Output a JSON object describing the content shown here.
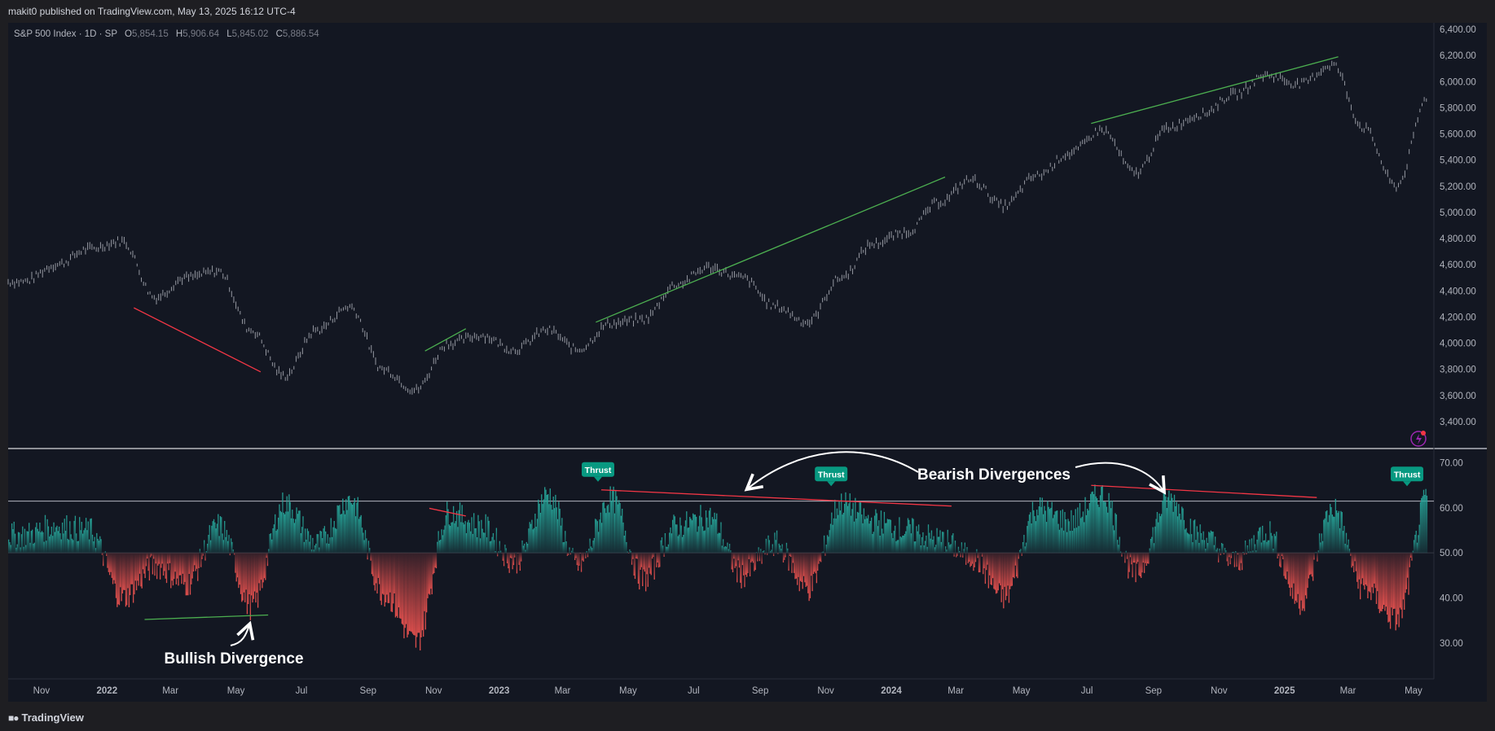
{
  "header": {
    "published": "makit0 published on TradingView.com, May 13, 2025 16:12 UTC-4"
  },
  "footer": {
    "brand": "TradingView",
    "logo_icon": "tradingview-logo-icon"
  },
  "legend": {
    "symbol": "S&P 500 Index · 1D · SP",
    "open_label": "O",
    "open": "5,854.15",
    "high_label": "H",
    "high": "5,906.64",
    "low_label": "L",
    "low": "5,845.02",
    "close_label": "C",
    "close": "5,886.54"
  },
  "colors": {
    "background": "#131722",
    "frame": "#1e1e22",
    "price": "#9598a1",
    "bull": "#26a69a",
    "bear": "#ef5350",
    "trend_green": "#4caf50",
    "trend_red": "#f23645",
    "thrust_badge": "#089981"
  },
  "chart_data": [
    {
      "type": "line",
      "title": "S&P 500 Index · 1D · SP",
      "ylim": [
        3200,
        6450
      ],
      "yticks": [
        "6,400.00",
        "6,200.00",
        "6,000.00",
        "5,800.00",
        "5,600.00",
        "5,400.00",
        "5,200.00",
        "5,000.00",
        "4,800.00",
        "4,600.00",
        "4,400.00",
        "4,200.00",
        "4,000.00",
        "3,800.00",
        "3,600.00",
        "3,400.00"
      ],
      "x_ticks": [
        "Nov",
        "2022",
        "Mar",
        "May",
        "Jul",
        "Sep",
        "Nov",
        "2023",
        "Mar",
        "May",
        "Jul",
        "Sep",
        "Nov",
        "2024",
        "Mar",
        "May",
        "Jul",
        "Sep",
        "Nov",
        "2025",
        "Mar",
        "May"
      ],
      "x": [
        "2021-10",
        "2021-11",
        "2021-12",
        "2022-01",
        "2022-02",
        "2022-03",
        "2022-04",
        "2022-05",
        "2022-06",
        "2022-07",
        "2022-08",
        "2022-09",
        "2022-10",
        "2022-11",
        "2022-12",
        "2023-01",
        "2023-02",
        "2023-03",
        "2023-04",
        "2023-05",
        "2023-06",
        "2023-07",
        "2023-08",
        "2023-09",
        "2023-10",
        "2023-11",
        "2023-12",
        "2024-01",
        "2024-02",
        "2024-03",
        "2024-04",
        "2024-05",
        "2024-06",
        "2024-07",
        "2024-08",
        "2024-09",
        "2024-10",
        "2024-11",
        "2024-12",
        "2025-01",
        "2025-02",
        "2025-03",
        "2025-04",
        "2025-05"
      ],
      "values": [
        4470,
        4600,
        4720,
        4780,
        4350,
        4500,
        4550,
        4100,
        3750,
        4100,
        4280,
        3800,
        3640,
        4000,
        4060,
        3950,
        4100,
        3950,
        4150,
        4180,
        4450,
        4580,
        4500,
        4280,
        4160,
        4500,
        4760,
        4850,
        5080,
        5250,
        5050,
        5280,
        5450,
        5630,
        5300,
        5650,
        5750,
        5900,
        6050,
        5980,
        6130,
        5650,
        5200,
        5886.54
      ],
      "trend_lines": [
        {
          "color": "bear",
          "from": [
            "2022-01-26",
            4270
          ],
          "to": [
            "2022-05-24",
            3780
          ]
        },
        {
          "color": "bull",
          "from": [
            "2022-10-24",
            3940
          ],
          "to": [
            "2022-12-01",
            4110
          ]
        },
        {
          "color": "bull",
          "from": [
            "2023-04-01",
            4160
          ],
          "to": [
            "2024-02-20",
            5270
          ]
        },
        {
          "color": "bull",
          "from": [
            "2024-07-05",
            5680
          ],
          "to": [
            "2025-02-20",
            6190
          ]
        }
      ]
    },
    {
      "type": "area",
      "ylim": [
        22,
        73
      ],
      "yticks": [
        "70.00",
        "60.00",
        "50.00",
        "40.00",
        "30.00"
      ],
      "baseline": 50,
      "threshold": 61.5,
      "x": [
        "2021-10",
        "2021-11",
        "2021-12",
        "2022-01",
        "2022-02",
        "2022-03",
        "2022-04",
        "2022-05",
        "2022-06",
        "2022-07",
        "2022-08",
        "2022-09",
        "2022-10",
        "2022-11",
        "2022-12",
        "2023-01",
        "2023-02",
        "2023-03",
        "2023-04",
        "2023-05",
        "2023-06",
        "2023-07",
        "2023-08",
        "2023-09",
        "2023-10",
        "2023-11",
        "2023-12",
        "2024-01",
        "2024-02",
        "2024-03",
        "2024-04",
        "2024-05",
        "2024-06",
        "2024-07",
        "2024-08",
        "2024-09",
        "2024-10",
        "2024-11",
        "2024-12",
        "2025-01",
        "2025-02",
        "2025-03",
        "2025-04",
        "2025-05"
      ],
      "values": [
        54,
        56,
        55,
        40,
        47,
        43,
        56,
        38,
        61,
        52,
        62,
        41,
        30,
        59,
        56,
        48,
        63,
        47,
        62,
        44,
        56,
        58,
        45,
        52,
        42,
        61,
        57,
        55,
        53,
        49,
        40,
        60,
        57,
        63,
        45,
        62,
        54,
        48,
        55,
        39,
        60,
        42,
        35,
        63
      ],
      "annotations": [
        {
          "text": "Thrust",
          "at": "2023-04-03",
          "value": 64
        },
        {
          "text": "Thrust",
          "at": "2023-11-06",
          "value": 63
        },
        {
          "text": "Thrust",
          "at": "2025-04-25",
          "value": 63
        },
        {
          "text": "Bearish Divergences"
        },
        {
          "text": "Bullish Divergence"
        }
      ],
      "trend_lines": [
        {
          "color": "bull",
          "from": [
            "2022-02-05",
            35.2
          ],
          "to": [
            "2022-05-31",
            36.2
          ]
        },
        {
          "color": "bear",
          "from": [
            "2022-10-28",
            59.9
          ],
          "to": [
            "2022-12-01",
            58.2
          ]
        },
        {
          "color": "bear",
          "from": [
            "2023-04-06",
            64.0
          ],
          "to": [
            "2024-02-26",
            60.4
          ]
        },
        {
          "color": "bear",
          "from": [
            "2024-07-05",
            65.0
          ],
          "to": [
            "2025-01-31",
            62.3
          ]
        }
      ]
    }
  ]
}
